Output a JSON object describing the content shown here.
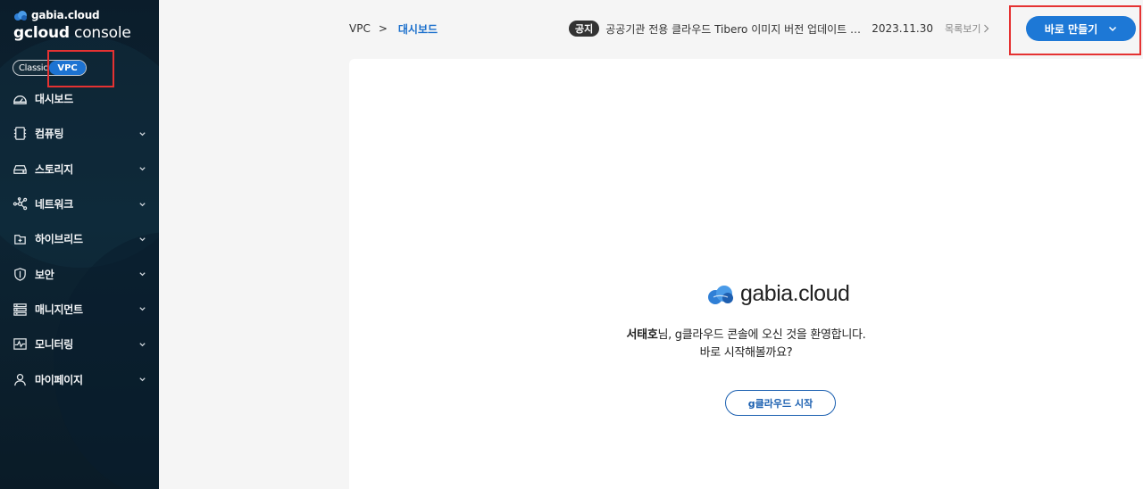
{
  "sidebar": {
    "brand_small": "gabia.cloud",
    "brand_title_bold": "gcloud",
    "brand_title_light": "console",
    "mode_classic": "Classic",
    "mode_vpc": "VPC",
    "items": [
      {
        "label": "대시보드",
        "icon": "dashboard-icon",
        "has_chevron": false
      },
      {
        "label": "컴퓨팅",
        "icon": "chip-icon",
        "has_chevron": true
      },
      {
        "label": "스토리지",
        "icon": "storage-icon",
        "has_chevron": true
      },
      {
        "label": "네트워크",
        "icon": "network-icon",
        "has_chevron": true
      },
      {
        "label": "하이브리드",
        "icon": "hybrid-icon",
        "has_chevron": true
      },
      {
        "label": "보안",
        "icon": "shield-icon",
        "has_chevron": true
      },
      {
        "label": "매니지먼트",
        "icon": "management-icon",
        "has_chevron": true
      },
      {
        "label": "모니터링",
        "icon": "monitor-icon",
        "has_chevron": true
      },
      {
        "label": "마이페이지",
        "icon": "user-icon",
        "has_chevron": true
      }
    ]
  },
  "breadcrumb": {
    "root": "VPC",
    "separator": ">",
    "current": "대시보드"
  },
  "notice": {
    "badge": "공지",
    "text": "공공기관 전용 클라우드 Tibero 이미지 버전 업데이트 …",
    "date": "2023.11.30",
    "list_label": "목록보기"
  },
  "header": {
    "create_label": "바로 만들기"
  },
  "main": {
    "logo_text": "gabia.cloud",
    "user_name": "서태호",
    "welcome_line1_rest": "님, g클라우드 콘솔에 오신 것을 환영합니다.",
    "welcome_line2": "바로 시작해볼까요?",
    "start_label": "g클라우드 시작"
  },
  "colors": {
    "accent": "#1d78d6",
    "sidebar_bg": "#0b1d2b",
    "highlight": "#e53232"
  }
}
